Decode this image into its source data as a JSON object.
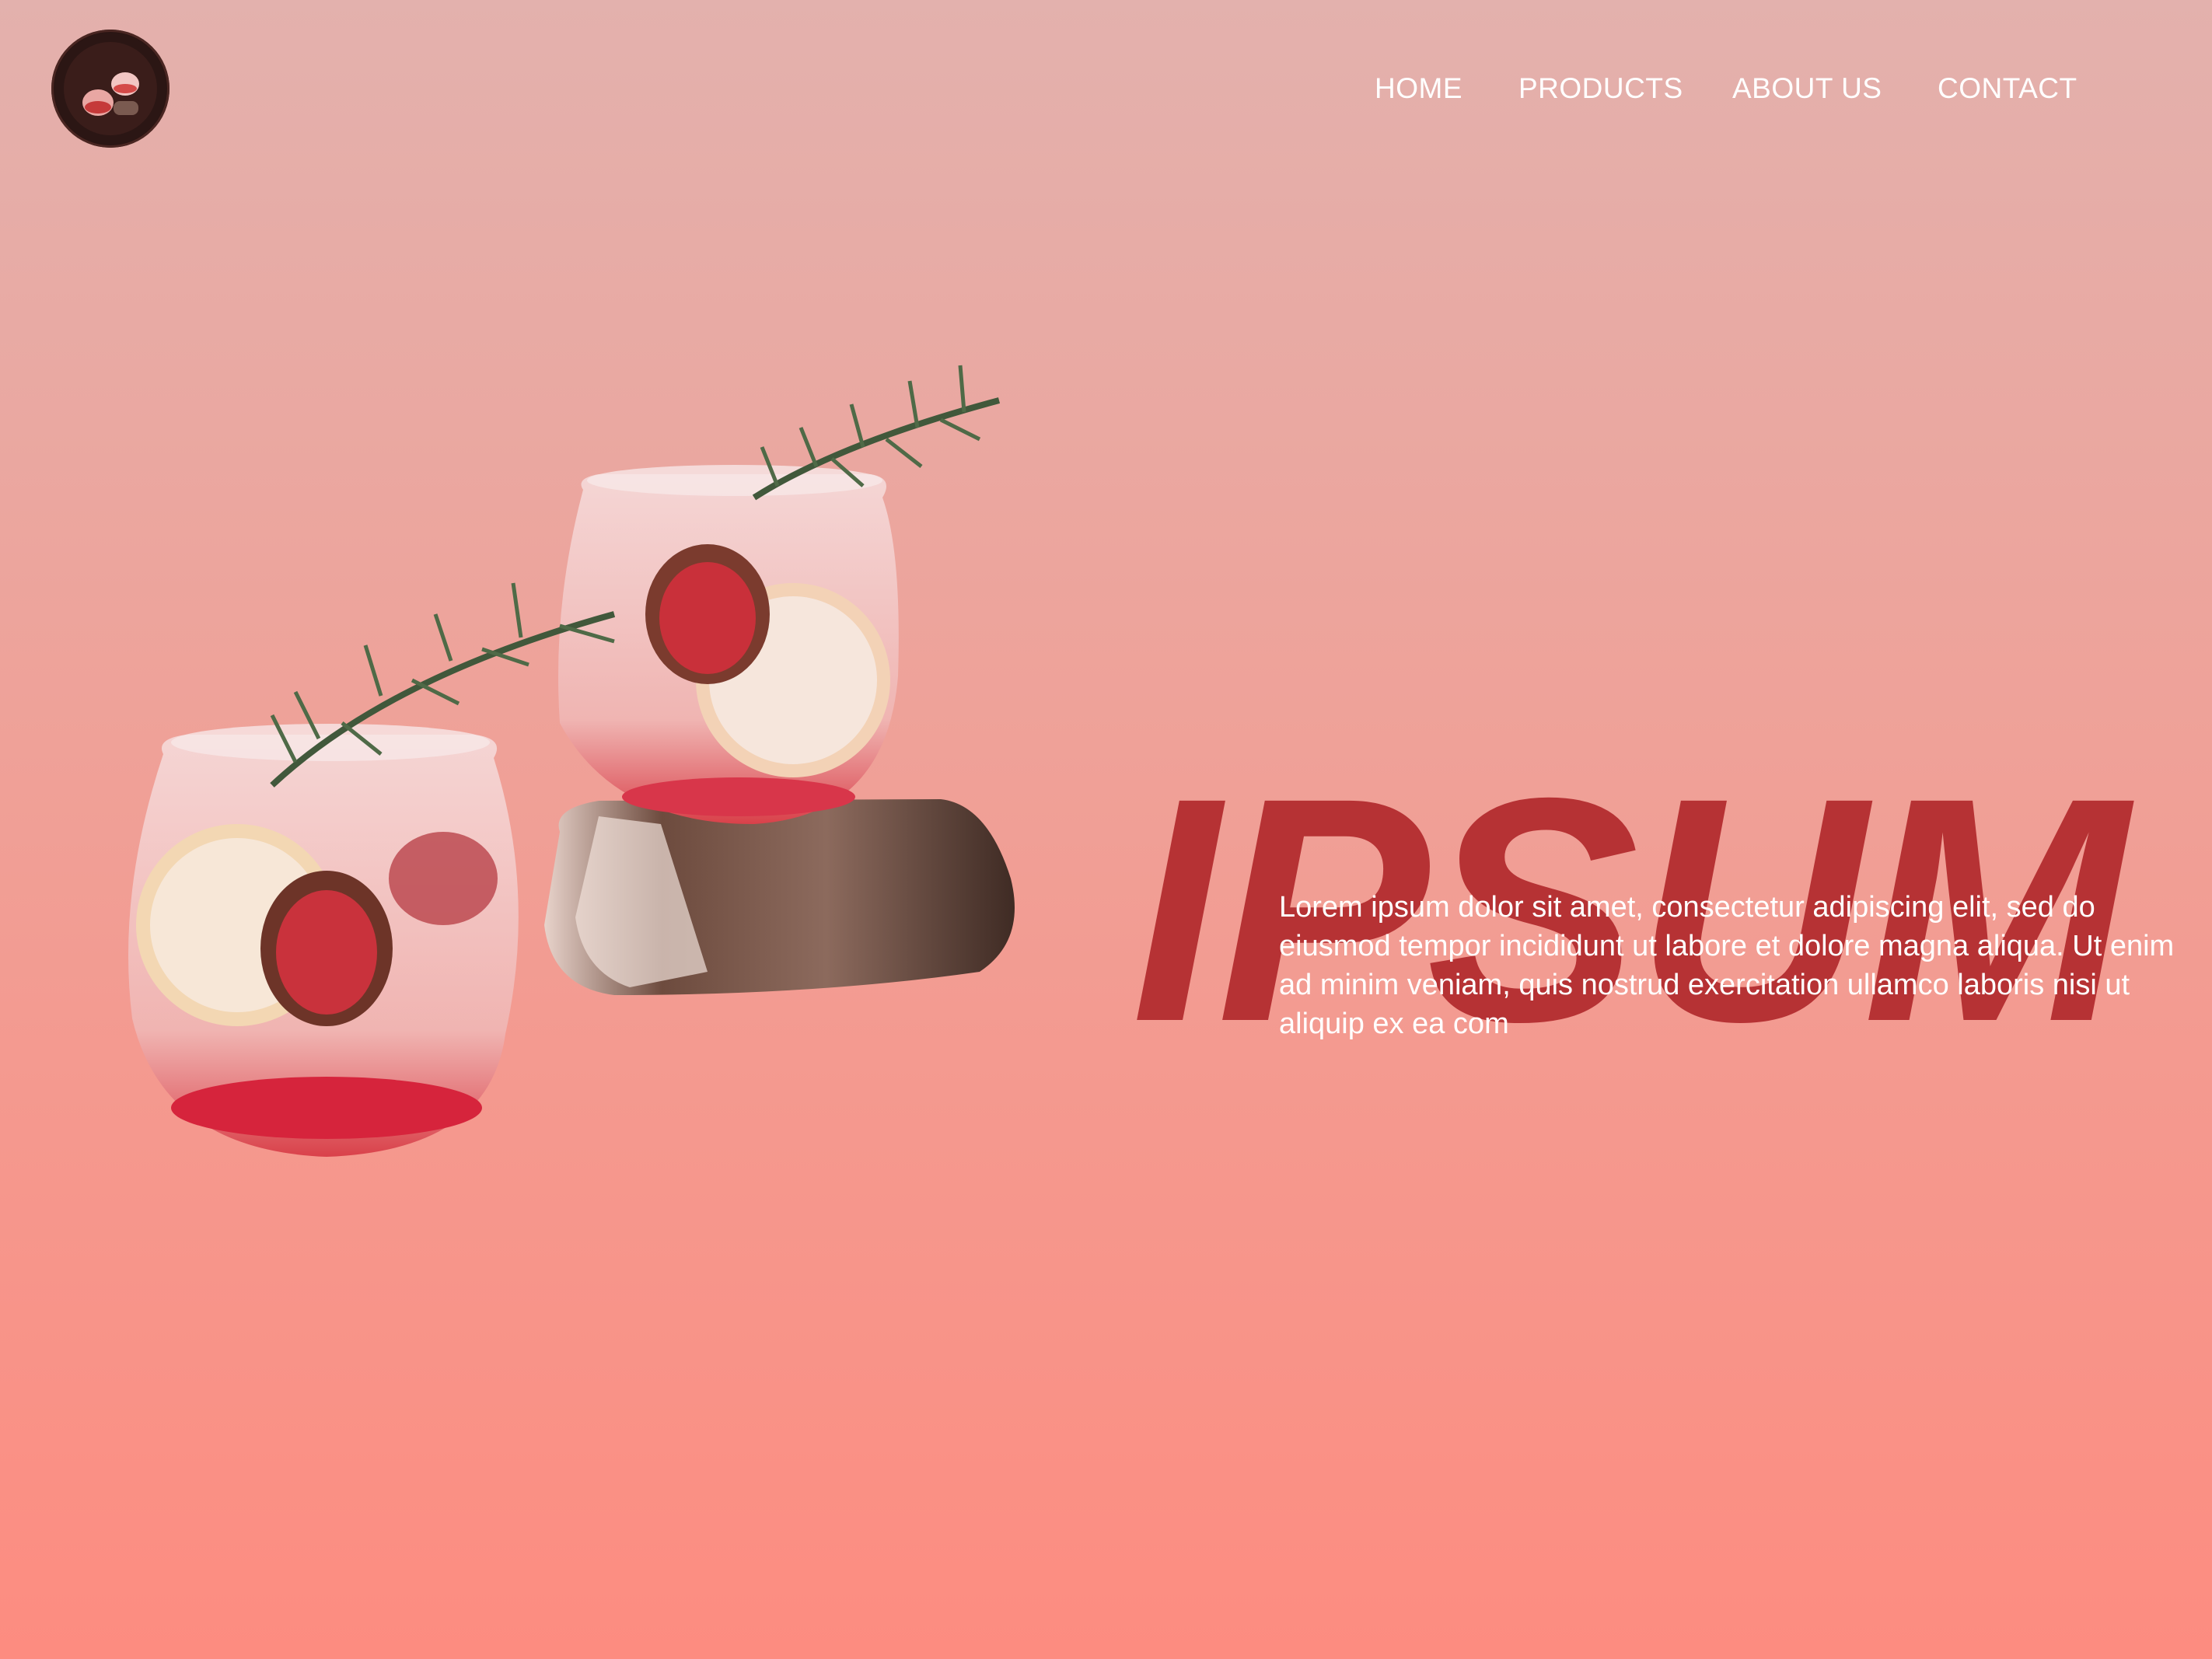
{
  "logo": {
    "icon": "cocktail-logo-icon"
  },
  "nav": {
    "items": [
      {
        "label": "HOME"
      },
      {
        "label": "PRODUCTS"
      },
      {
        "label": "ABOUT US"
      },
      {
        "label": "CONTACT"
      }
    ]
  },
  "hero": {
    "headline": "IPSUM",
    "body": "Lorem ipsum dolor sit amet, consectetur adipiscing elit, sed do eiusmod tempor incididunt ut labore et dolore magna aliqua. Ut enim ad minim veniam, quis nostrud exercitation ullamco laboris nisi ut aliquip ex ea com",
    "image_icon": "cocktail-glasses-image"
  },
  "colors": {
    "background_top": "#e3b1ad",
    "background_bottom": "#fd8c80",
    "headline": "#b63234",
    "nav_text": "#ffffff",
    "body_text": "#ffffff"
  }
}
